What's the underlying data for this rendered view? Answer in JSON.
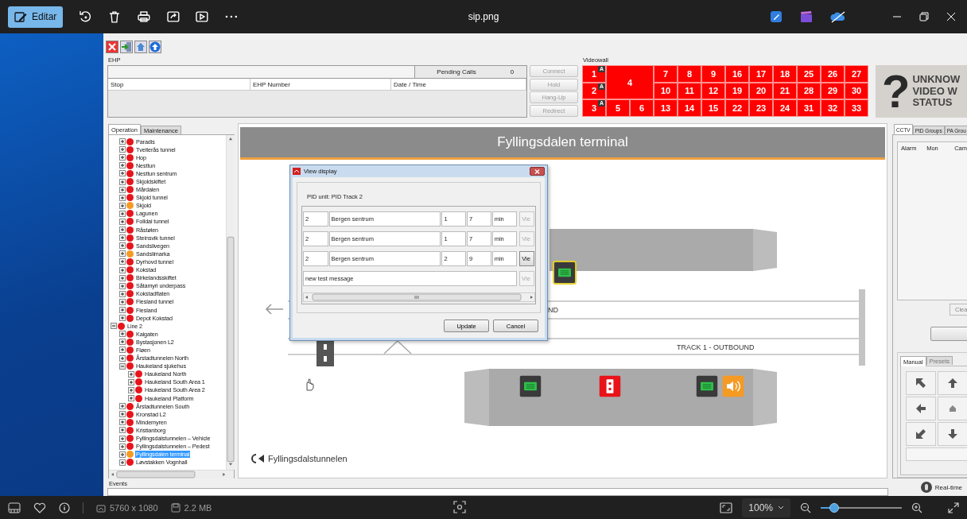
{
  "viewer": {
    "edit_label": "Editar",
    "file_name": "sip.png",
    "dimensions": "5760 x 1080",
    "file_size": "2.2 MB",
    "zoom_percent": "100%",
    "zoom": {
      "level": 0.17
    }
  },
  "ehp": {
    "title": "EHP",
    "pending_label": "Pending Calls",
    "pending_count": "0",
    "columns": [
      "Stop",
      "EHP Number",
      "Date / Time"
    ],
    "buttons": [
      {
        "label": "Connect",
        "disabled": true
      },
      {
        "label": "Hold",
        "disabled": true
      },
      {
        "label": "Hang-Up",
        "disabled": true
      },
      {
        "label": "Redirect",
        "disabled": true
      }
    ]
  },
  "videowall": {
    "title": "Videowall",
    "status_symbol": "?",
    "status_lines": [
      "UNKNOW",
      "VIDEO W",
      "STATUS"
    ],
    "cells": [
      {
        "label": "1",
        "kind": "monitor",
        "badge": "A"
      },
      {
        "label": "4",
        "kind": "large"
      },
      {
        "label": "7",
        "kind": "monitor"
      },
      {
        "label": "8",
        "kind": "monitor"
      },
      {
        "label": "9",
        "kind": "monitor"
      },
      {
        "label": "16",
        "kind": "monitor"
      },
      {
        "label": "17",
        "kind": "monitor"
      },
      {
        "label": "18",
        "kind": "monitor"
      },
      {
        "label": "25",
        "kind": "monitor"
      },
      {
        "label": "26",
        "kind": "monitor"
      },
      {
        "label": "27",
        "kind": "monitor"
      },
      {
        "label": "2",
        "kind": "monitor",
        "badge": "A"
      },
      {
        "label": "10",
        "kind": "monitor"
      },
      {
        "label": "11",
        "kind": "monitor"
      },
      {
        "label": "12",
        "kind": "monitor"
      },
      {
        "label": "19",
        "kind": "monitor"
      },
      {
        "label": "20",
        "kind": "monitor"
      },
      {
        "label": "21",
        "kind": "monitor"
      },
      {
        "label": "28",
        "kind": "monitor"
      },
      {
        "label": "29",
        "kind": "monitor"
      },
      {
        "label": "30",
        "kind": "monitor"
      },
      {
        "label": "3",
        "kind": "monitor",
        "badge": "A"
      },
      {
        "label": "5",
        "kind": "monitor"
      },
      {
        "label": "6",
        "kind": "monitor"
      },
      {
        "label": "13",
        "kind": "monitor"
      },
      {
        "label": "14",
        "kind": "monitor"
      },
      {
        "label": "15",
        "kind": "monitor"
      },
      {
        "label": "22",
        "kind": "monitor"
      },
      {
        "label": "23",
        "kind": "monitor"
      },
      {
        "label": "24",
        "kind": "monitor"
      },
      {
        "label": "31",
        "kind": "monitor"
      },
      {
        "label": "32",
        "kind": "monitor"
      },
      {
        "label": "33",
        "kind": "monitor"
      }
    ]
  },
  "left_tabs": [
    {
      "label": "Operation",
      "selected": true
    },
    {
      "label": "Maintenance",
      "selected": false
    }
  ],
  "tree": {
    "continued_items": [
      {
        "label": "Paradis",
        "color": "#e8141a",
        "expanded": false,
        "selected": false
      },
      {
        "label": "Tveiterås tunnel",
        "color": "#e8141a",
        "expanded": false,
        "selected": false
      },
      {
        "label": "Hop",
        "color": "#e8141a",
        "expanded": false,
        "selected": false
      },
      {
        "label": "Nesttun",
        "color": "#e8141a",
        "expanded": false,
        "selected": false
      },
      {
        "label": "Nesttun sentrum",
        "color": "#e8141a",
        "expanded": false,
        "selected": false
      },
      {
        "label": "Skjoldskiftet",
        "color": "#e8141a",
        "expanded": false,
        "selected": false
      },
      {
        "label": "Mårdalen",
        "color": "#e8141a",
        "expanded": false,
        "selected": false
      },
      {
        "label": "Skjold tunnel",
        "color": "#e8141a",
        "expanded": false,
        "selected": false
      },
      {
        "label": "Skjold",
        "color": "#f59a23",
        "expanded": false,
        "selected": false
      },
      {
        "label": "Lagunen",
        "color": "#e8141a",
        "expanded": false,
        "selected": false
      },
      {
        "label": "Folldal tunnel",
        "color": "#e8141a",
        "expanded": false,
        "selected": false
      },
      {
        "label": "Råstølen",
        "color": "#e8141a",
        "expanded": false,
        "selected": false
      },
      {
        "label": "Steinsvik tunnel",
        "color": "#e8141a",
        "expanded": false,
        "selected": false
      },
      {
        "label": "Sandslivegen",
        "color": "#e8141a",
        "expanded": false,
        "selected": false
      },
      {
        "label": "Sandslimarka",
        "color": "#f59a23",
        "expanded": false,
        "selected": false
      },
      {
        "label": "Dyrhovd tunnel",
        "color": "#e8141a",
        "expanded": false,
        "selected": false
      },
      {
        "label": "Kokstad",
        "color": "#e8141a",
        "expanded": false,
        "selected": false
      },
      {
        "label": "Birkelandsskiftet",
        "color": "#e8141a",
        "expanded": false,
        "selected": false
      },
      {
        "label": "Såtamyri underpass",
        "color": "#e8141a",
        "expanded": false,
        "selected": false
      },
      {
        "label": "Kokstadflaten",
        "color": "#e8141a",
        "expanded": false,
        "selected": false
      },
      {
        "label": "Flesland tunnel",
        "color": "#e8141a",
        "expanded": false,
        "selected": false
      },
      {
        "label": "Flesland",
        "color": "#e8141a",
        "expanded": false,
        "selected": false
      },
      {
        "label": "Depot Kokstad",
        "color": "#e8141a",
        "expanded": false,
        "selected": false
      }
    ],
    "items": [
      {
        "label": "Line 2",
        "color": "#e8141a",
        "expanded": true,
        "selected": false,
        "children": [
          {
            "label": "Kaigaten",
            "color": "#e8141a",
            "expanded": false,
            "selected": false
          },
          {
            "label": "Bystasjonen L2",
            "color": "#e8141a",
            "expanded": false,
            "selected": false
          },
          {
            "label": "Fløen",
            "color": "#e8141a",
            "expanded": false,
            "selected": false
          },
          {
            "label": "Årstadtunnelen North",
            "color": "#e8141a",
            "expanded": false,
            "selected": false
          },
          {
            "label": "Haukeland sjukehus",
            "color": "#e8141a",
            "expanded": true,
            "selected": false,
            "children": [
              {
                "label": "Haukeland North",
                "color": "#e8141a",
                "expanded": false,
                "selected": false
              },
              {
                "label": "Haukeland South Area 1",
                "color": "#e8141a",
                "expanded": false,
                "selected": false
              },
              {
                "label": "Haukeland South Area 2",
                "color": "#e8141a",
                "expanded": false,
                "selected": false
              },
              {
                "label": "Haukeland Platform",
                "color": "#e8141a",
                "expanded": false,
                "selected": false
              }
            ]
          },
          {
            "label": "Årstadtunnelen South",
            "color": "#e8141a",
            "expanded": false,
            "selected": false
          },
          {
            "label": "Kronstad L2",
            "color": "#e8141a",
            "expanded": false,
            "selected": false
          },
          {
            "label": "Mindemyren",
            "color": "#e8141a",
            "expanded": false,
            "selected": false
          },
          {
            "label": "Kristianborg",
            "color": "#e8141a",
            "expanded": false,
            "selected": false
          },
          {
            "label": "Fyllingsdalstunnelen – Vehicle",
            "color": "#e8141a",
            "expanded": false,
            "selected": false
          },
          {
            "label": "Fyllingsdalstunnelen – Pedest",
            "color": "#e8141a",
            "expanded": false,
            "selected": false
          },
          {
            "label": "Fyllingsdalen terminal",
            "color": "#f59a23",
            "expanded": false,
            "selected": true
          },
          {
            "label": "Løvstakken Vognhall",
            "color": "#e8141a",
            "expanded": false,
            "selected": false
          }
        ]
      }
    ]
  },
  "canvas": {
    "title": "Fyllingsdalen terminal",
    "track_labels": [
      "ND",
      "TRACK 1 - OUTBOUND"
    ],
    "logo_text": "Fyllingsdalstunnelen",
    "devices": [
      {
        "kind": "pid",
        "selected": true
      },
      {
        "kind": "pid",
        "selected": false
      },
      {
        "kind": "alarm",
        "selected": false
      },
      {
        "kind": "pid",
        "selected": false
      },
      {
        "kind": "speaker",
        "selected": false
      }
    ]
  },
  "dialog": {
    "title": "View display",
    "pid_unit": "PID unit: PID Track 2",
    "rows": [
      {
        "kind": "departure",
        "fields": [
          "2",
          "Bergen sentrum",
          "1",
          "7",
          "min"
        ],
        "button": "Vie",
        "disabled": true
      },
      {
        "kind": "departure",
        "fields": [
          "2",
          "Bergen sentrum",
          "1",
          "7",
          "min"
        ],
        "button": "Vie",
        "disabled": true
      },
      {
        "kind": "departure",
        "fields": [
          "2",
          "Bergen sentrum",
          "2",
          "9",
          "min"
        ],
        "button": "Vie",
        "disabled": false
      },
      {
        "kind": "message",
        "fields": [
          "new test message"
        ],
        "button": "Vie",
        "disabled": true
      }
    ],
    "buttons": [
      "Update",
      "Cancel"
    ]
  },
  "right_tabs": [
    {
      "label": "CCTV",
      "selected": true
    },
    {
      "label": "PID Groups",
      "selected": false
    },
    {
      "label": "PA Grou",
      "selected": false
    }
  ],
  "alarm_columns": [
    "Alarm",
    "Mon",
    "Cam"
  ],
  "clear_button": "Clea",
  "ptz_tabs": [
    {
      "label": "Manual",
      "selected": true
    },
    {
      "label": "Presets",
      "selected": false
    }
  ],
  "ptz_buttons": [
    {
      "kind": "up-left"
    },
    {
      "kind": "up"
    },
    {
      "kind": "left"
    },
    {
      "kind": "home"
    },
    {
      "kind": "down-left"
    },
    {
      "kind": "down"
    }
  ],
  "events": {
    "title": "Events",
    "mode": "Real-time"
  }
}
